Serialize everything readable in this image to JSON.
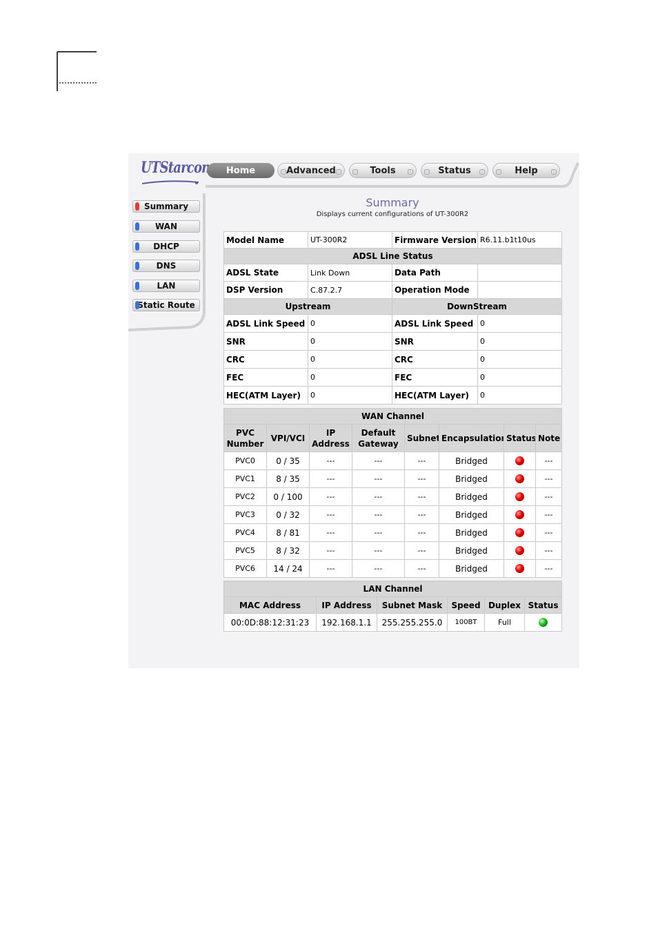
{
  "logo": {
    "text": "UTStarcom"
  },
  "nav": {
    "tabs": [
      "Home",
      "Advanced",
      "Tools",
      "Status",
      "Help"
    ],
    "active": "Home"
  },
  "sidebar": {
    "items": [
      "Summary",
      "WAN",
      "DHCP",
      "DNS",
      "LAN",
      "Static Route"
    ],
    "active": "Summary"
  },
  "page": {
    "title": "Summary",
    "subtitle": "Displays current configurations of UT-300R2"
  },
  "device": {
    "model_label": "Model Name",
    "model_value": "UT-300R2",
    "firmware_label": "Firmware Version",
    "firmware_value": "R6.11.b1t10us"
  },
  "adsl": {
    "section_title": "ADSL Line Status",
    "state_label": "ADSL State",
    "state_value": "Link Down",
    "datapath_label": "Data Path",
    "datapath_value": "",
    "dsp_label": "DSP Version",
    "dsp_value": "C.87.2.7",
    "opmode_label": "Operation Mode",
    "opmode_value": "",
    "upstream_title": "Upstream",
    "downstream_title": "DownStream",
    "rows": [
      {
        "label": "ADSL Link Speed",
        "up": "0",
        "down": "0"
      },
      {
        "label": "SNR",
        "up": "0",
        "down": "0"
      },
      {
        "label": "CRC",
        "up": "0",
        "down": "0"
      },
      {
        "label": "FEC",
        "up": "0",
        "down": "0"
      },
      {
        "label": "HEC(ATM Layer)",
        "up": "0",
        "down": "0"
      }
    ]
  },
  "wan": {
    "section_title": "WAN Channel",
    "headers": {
      "pvc_l1": "PVC",
      "pvc_l2": "Number",
      "vpivci": "VPI/VCI",
      "ip_l1": "IP",
      "ip_l2": "Address",
      "gw_l1": "Default",
      "gw_l2": "Gateway",
      "subnet": "Subnet",
      "encap": "Encapsulation",
      "status": "Status",
      "note": "Note"
    },
    "rows": [
      {
        "pvc": "PVC0",
        "vpivci": "0 / 35",
        "ip": "---",
        "gw": "---",
        "subnet": "---",
        "encap": "Bridged",
        "status": "down",
        "note": "---"
      },
      {
        "pvc": "PVC1",
        "vpivci": "8 / 35",
        "ip": "---",
        "gw": "---",
        "subnet": "---",
        "encap": "Bridged",
        "status": "down",
        "note": "---"
      },
      {
        "pvc": "PVC2",
        "vpivci": "0 / 100",
        "ip": "---",
        "gw": "---",
        "subnet": "---",
        "encap": "Bridged",
        "status": "down",
        "note": "---"
      },
      {
        "pvc": "PVC3",
        "vpivci": "0 / 32",
        "ip": "---",
        "gw": "---",
        "subnet": "---",
        "encap": "Bridged",
        "status": "down",
        "note": "---"
      },
      {
        "pvc": "PVC4",
        "vpivci": "8 / 81",
        "ip": "---",
        "gw": "---",
        "subnet": "---",
        "encap": "Bridged",
        "status": "down",
        "note": "---"
      },
      {
        "pvc": "PVC5",
        "vpivci": "8 / 32",
        "ip": "---",
        "gw": "---",
        "subnet": "---",
        "encap": "Bridged",
        "status": "down",
        "note": "---"
      },
      {
        "pvc": "PVC6",
        "vpivci": "14 / 24",
        "ip": "---",
        "gw": "---",
        "subnet": "---",
        "encap": "Bridged",
        "status": "down",
        "note": "---"
      }
    ]
  },
  "lan": {
    "section_title": "LAN Channel",
    "headers": {
      "mac": "MAC Address",
      "ip": "IP Address",
      "mask": "Subnet Mask",
      "speed": "Speed",
      "duplex": "Duplex",
      "status": "Status"
    },
    "row": {
      "mac": "00:0D:88:12:31:23",
      "ip": "192.168.1.1",
      "mask": "255.255.255.0",
      "speed": "100BT",
      "duplex": "Full",
      "status": "up"
    }
  },
  "colors": {
    "accent": "#6c6aa8",
    "header_bg": "#d7d7d7",
    "status_down": "#e30000",
    "status_up": "#22b322",
    "sidebar_active": "#e23a3a",
    "sidebar_inactive": "#3a6fd6"
  }
}
